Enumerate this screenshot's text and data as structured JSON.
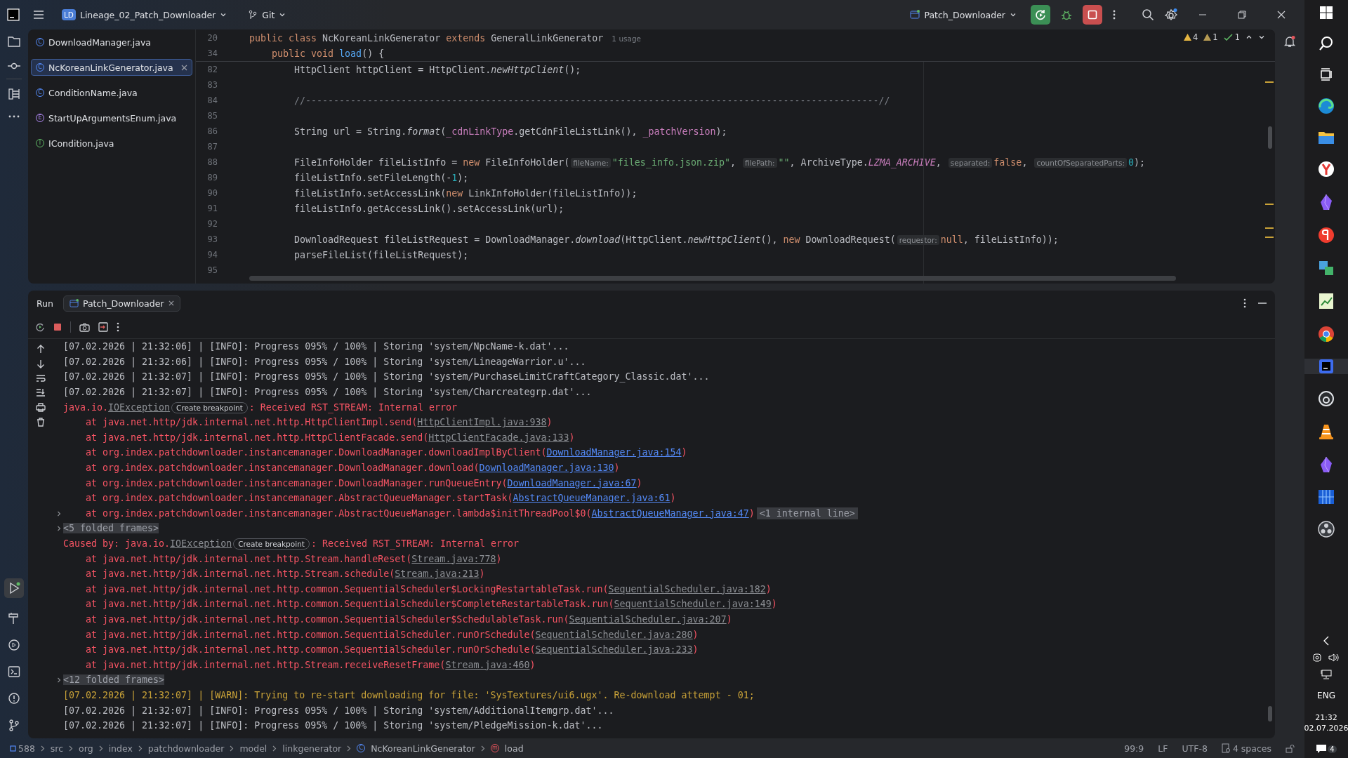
{
  "title_bar": {
    "project_badge": "LD",
    "project": "Lineage_02_Patch_Downloader",
    "vcs": "Git",
    "run_config": "Patch_Downloader"
  },
  "open_files": [
    {
      "name": "DownloadManager.java",
      "kind": "class",
      "letter": "C",
      "selected": false
    },
    {
      "name": "NcKoreanLinkGenerator.java",
      "kind": "class",
      "letter": "C",
      "selected": true
    },
    {
      "name": "ConditionName.java",
      "kind": "class",
      "letter": "C",
      "selected": false
    },
    {
      "name": "StartUpArgumentsEnum.java",
      "kind": "enum",
      "letter": "E",
      "selected": false
    },
    {
      "name": "ICondition.java",
      "kind": "interface",
      "letter": "I",
      "selected": false
    }
  ],
  "inspections": [
    {
      "kind": "warning",
      "count": "4"
    },
    {
      "kind": "weak",
      "count": "1"
    },
    {
      "kind": "ok",
      "count": "1"
    }
  ],
  "code_lines": [
    {
      "number": "20",
      "kind": "class",
      "tokens": [
        {
          "text": "public class ",
          "kind": "kw"
        },
        {
          "text": "NcKoreanLinkGenerator ",
          "kind": "plain"
        },
        {
          "text": "extends ",
          "kind": "kw"
        },
        {
          "text": "GeneralLinkGenerator",
          "kind": "plain"
        },
        {
          "text": "1 usage",
          "kind": "usage"
        }
      ]
    },
    {
      "number": "34",
      "kind": "method",
      "tokens": [
        {
          "text": "public void ",
          "kind": "kw"
        },
        {
          "text": "load",
          "kind": "decl"
        },
        {
          "text": "() {",
          "kind": "plain"
        }
      ]
    },
    {
      "number": "82",
      "kind": "body",
      "tokens": [
        {
          "text": "HttpClient httpClient = HttpClient.",
          "kind": "plain"
        },
        {
          "text": "newHttpClient",
          "kind": "static"
        },
        {
          "text": "();",
          "kind": "plain"
        }
      ]
    },
    {
      "number": "83",
      "kind": "body"
    },
    {
      "number": "84",
      "kind": "body",
      "tokens": [
        {
          "text": "//------------------------------------------------------------------------------------------------------//",
          "kind": "comment"
        }
      ]
    },
    {
      "number": "85",
      "kind": "body"
    },
    {
      "number": "86",
      "kind": "body",
      "tokens": [
        {
          "text": "String url = String.",
          "kind": "plain"
        },
        {
          "text": "format",
          "kind": "static"
        },
        {
          "text": "(",
          "kind": "plain"
        },
        {
          "text": "_cdnLinkType",
          "kind": "field"
        },
        {
          "text": ".getCdnFileListLink(), ",
          "kind": "plain"
        },
        {
          "text": "_patchVersion",
          "kind": "field"
        },
        {
          "text": ");",
          "kind": "plain"
        }
      ]
    },
    {
      "number": "87",
      "kind": "body"
    },
    {
      "number": "88",
      "kind": "body",
      "tokens": [
        {
          "text": "FileInfoHolder fileListInfo = ",
          "kind": "plain"
        },
        {
          "text": "new ",
          "kind": "kw"
        },
        {
          "text": "FileInfoHolder(",
          "kind": "plain"
        },
        {
          "text": "fileName:",
          "kind": "hint"
        },
        {
          "text": "\"files_info.json.zip\"",
          "kind": "string"
        },
        {
          "text": ", ",
          "kind": "plain"
        },
        {
          "text": "filePath:",
          "kind": "hint"
        },
        {
          "text": "\"\"",
          "kind": "string"
        },
        {
          "text": ", ArchiveType.",
          "kind": "plain"
        },
        {
          "text": "LZMA_ARCHIVE",
          "kind": "const"
        },
        {
          "text": ", ",
          "kind": "plain"
        },
        {
          "text": "separated:",
          "kind": "hint"
        },
        {
          "text": "false",
          "kind": "kw"
        },
        {
          "text": ", ",
          "kind": "plain"
        },
        {
          "text": "countOfSeparatedParts:",
          "kind": "hint"
        },
        {
          "text": "0",
          "kind": "num"
        },
        {
          "text": ");",
          "kind": "plain"
        }
      ]
    },
    {
      "number": "89",
      "kind": "body",
      "tokens": [
        {
          "text": "fileListInfo.setFileLength(-",
          "kind": "plain"
        },
        {
          "text": "1",
          "kind": "num"
        },
        {
          "text": ");",
          "kind": "plain"
        }
      ]
    },
    {
      "number": "90",
      "kind": "body",
      "tokens": [
        {
          "text": "fileListInfo.setAccessLink(",
          "kind": "plain"
        },
        {
          "text": "new ",
          "kind": "kw"
        },
        {
          "text": "LinkInfoHolder(fileListInfo));",
          "kind": "plain"
        }
      ]
    },
    {
      "number": "91",
      "kind": "body",
      "tokens": [
        {
          "text": "fileListInfo.getAccessLink().setAccessLink(url);",
          "kind": "plain"
        }
      ]
    },
    {
      "number": "92",
      "kind": "body"
    },
    {
      "number": "93",
      "kind": "body",
      "tokens": [
        {
          "text": "DownloadRequest fileListRequest = DownloadManager.",
          "kind": "plain"
        },
        {
          "text": "download",
          "kind": "static"
        },
        {
          "text": "(HttpClient.",
          "kind": "plain"
        },
        {
          "text": "newHttpClient",
          "kind": "static"
        },
        {
          "text": "(), ",
          "kind": "plain"
        },
        {
          "text": "new ",
          "kind": "kw"
        },
        {
          "text": "DownloadRequest(",
          "kind": "plain"
        },
        {
          "text": "requestor:",
          "kind": "hint"
        },
        {
          "text": "null",
          "kind": "kw"
        },
        {
          "text": ", fileListInfo));",
          "kind": "plain"
        }
      ]
    },
    {
      "number": "94",
      "kind": "body",
      "tokens": [
        {
          "text": "parseFileList(fileListRequest);",
          "kind": "plain"
        }
      ]
    },
    {
      "number": "95",
      "kind": "body"
    }
  ],
  "run_panel": {
    "title": "Run",
    "tab": "Patch_Downloader",
    "lines": [
      {
        "kind": "info",
        "parts": [
          {
            "text": "[07.02.2026 | 21:32:06] | [INFO]: Progress 095% / 100% | Storing 'system/NpcName-k.dat'...",
            "kind": "text"
          }
        ]
      },
      {
        "kind": "info",
        "parts": [
          {
            "text": "[07.02.2026 | 21:32:06] | [INFO]: Progress 095% / 100% | Storing 'system/LineageWarrior.u'...",
            "kind": "text"
          }
        ]
      },
      {
        "kind": "info",
        "parts": [
          {
            "text": "[07.02.2026 | 21:32:07] | [INFO]: Progress 095% / 100% | Storing 'system/PurchaseLimitCraftCategory_Classic.dat'...",
            "kind": "text"
          }
        ]
      },
      {
        "kind": "info",
        "parts": [
          {
            "text": "[07.02.2026 | 21:32:07] | [INFO]: Progress 095% / 100% | Storing 'system/Charcreategrp.dat'...",
            "kind": "text"
          }
        ]
      },
      {
        "kind": "error",
        "parts": [
          {
            "text": "java.io.",
            "kind": "text"
          },
          {
            "text": "IOException",
            "kind": "link"
          },
          {
            "text": "Create breakpoint",
            "kind": "chip"
          },
          {
            "text": ": Received RST_STREAM: Internal error",
            "kind": "text"
          }
        ]
      },
      {
        "kind": "frame",
        "parts": [
          {
            "text": "at java.net.http/jdk.internal.net.http.HttpClientImpl.send(",
            "kind": "text"
          },
          {
            "text": "HttpClientImpl.java:938",
            "kind": "link"
          },
          {
            "text": ")",
            "kind": "text"
          }
        ]
      },
      {
        "kind": "frame",
        "parts": [
          {
            "text": "at java.net.http/jdk.internal.net.http.HttpClientFacade.send(",
            "kind": "text"
          },
          {
            "text": "HttpClientFacade.java:133",
            "kind": "link"
          },
          {
            "text": ")",
            "kind": "text"
          }
        ]
      },
      {
        "kind": "frame",
        "parts": [
          {
            "text": "at org.index.patchdownloader.instancemanager.DownloadManager.downloadImplByClient(",
            "kind": "text"
          },
          {
            "text": "DownloadManager.java:154",
            "kind": "project-link"
          },
          {
            "text": ")",
            "kind": "text"
          }
        ]
      },
      {
        "kind": "frame",
        "parts": [
          {
            "text": "at org.index.patchdownloader.instancemanager.DownloadManager.download(",
            "kind": "text"
          },
          {
            "text": "DownloadManager.java:130",
            "kind": "project-link"
          },
          {
            "text": ")",
            "kind": "text"
          }
        ]
      },
      {
        "kind": "frame",
        "parts": [
          {
            "text": "at org.index.patchdownloader.instancemanager.DownloadManager.runQueueEntry(",
            "kind": "text"
          },
          {
            "text": "DownloadManager.java:67",
            "kind": "project-link"
          },
          {
            "text": ")",
            "kind": "text"
          }
        ]
      },
      {
        "kind": "frame",
        "parts": [
          {
            "text": "at org.index.patchdownloader.instancemanager.AbstractQueueManager.startTask(",
            "kind": "text"
          },
          {
            "text": "AbstractQueueManager.java:61",
            "kind": "project-link"
          },
          {
            "text": ")",
            "kind": "text"
          }
        ]
      },
      {
        "kind": "frame",
        "expanded": false,
        "parts": [
          {
            "text": "at org.index.patchdownloader.instancemanager.AbstractQueueManager.lambda$initThreadPool$0(",
            "kind": "text"
          },
          {
            "text": "AbstractQueueManager.java:47",
            "kind": "project-link"
          },
          {
            "text": ")",
            "kind": "text"
          },
          {
            "text": "<1 internal line>",
            "kind": "badge"
          }
        ]
      },
      {
        "kind": "folded",
        "expanded": false,
        "parts": [
          {
            "text": "<5 folded frames>",
            "kind": "text"
          }
        ]
      },
      {
        "kind": "error",
        "parts": [
          {
            "text": "Caused by: java.io.",
            "kind": "text"
          },
          {
            "text": "IOException",
            "kind": "link"
          },
          {
            "text": "Create breakpoint",
            "kind": "chip"
          },
          {
            "text": ": Received RST_STREAM: Internal error",
            "kind": "text"
          }
        ]
      },
      {
        "kind": "frame",
        "parts": [
          {
            "text": "at java.net.http/jdk.internal.net.http.Stream.handleReset(",
            "kind": "text"
          },
          {
            "text": "Stream.java:778",
            "kind": "link"
          },
          {
            "text": ")",
            "kind": "text"
          }
        ]
      },
      {
        "kind": "frame",
        "parts": [
          {
            "text": "at java.net.http/jdk.internal.net.http.Stream.schedule(",
            "kind": "text"
          },
          {
            "text": "Stream.java:213",
            "kind": "link"
          },
          {
            "text": ")",
            "kind": "text"
          }
        ]
      },
      {
        "kind": "frame",
        "parts": [
          {
            "text": "at java.net.http/jdk.internal.net.http.common.SequentialScheduler$LockingRestartableTask.run(",
            "kind": "text"
          },
          {
            "text": "SequentialScheduler.java:182",
            "kind": "link"
          },
          {
            "text": ")",
            "kind": "text"
          }
        ]
      },
      {
        "kind": "frame",
        "parts": [
          {
            "text": "at java.net.http/jdk.internal.net.http.common.SequentialScheduler$CompleteRestartableTask.run(",
            "kind": "text"
          },
          {
            "text": "SequentialScheduler.java:149",
            "kind": "link"
          },
          {
            "text": ")",
            "kind": "text"
          }
        ]
      },
      {
        "kind": "frame",
        "parts": [
          {
            "text": "at java.net.http/jdk.internal.net.http.common.SequentialScheduler$SchedulableTask.run(",
            "kind": "text"
          },
          {
            "text": "SequentialScheduler.java:207",
            "kind": "link"
          },
          {
            "text": ")",
            "kind": "text"
          }
        ]
      },
      {
        "kind": "frame",
        "parts": [
          {
            "text": "at java.net.http/jdk.internal.net.http.common.SequentialScheduler.runOrSchedule(",
            "kind": "text"
          },
          {
            "text": "SequentialScheduler.java:280",
            "kind": "link"
          },
          {
            "text": ")",
            "kind": "text"
          }
        ]
      },
      {
        "kind": "frame",
        "parts": [
          {
            "text": "at java.net.http/jdk.internal.net.http.common.SequentialScheduler.runOrSchedule(",
            "kind": "text"
          },
          {
            "text": "SequentialScheduler.java:233",
            "kind": "link"
          },
          {
            "text": ")",
            "kind": "text"
          }
        ]
      },
      {
        "kind": "frame",
        "parts": [
          {
            "text": "at java.net.http/jdk.internal.net.http.Stream.receiveResetFrame(",
            "kind": "text"
          },
          {
            "text": "Stream.java:460",
            "kind": "link"
          },
          {
            "text": ")",
            "kind": "text"
          }
        ]
      },
      {
        "kind": "folded",
        "expanded": false,
        "parts": [
          {
            "text": "<12 folded frames>",
            "kind": "text"
          }
        ]
      },
      {
        "kind": "warn",
        "parts": [
          {
            "text": "[07.02.2026 | 21:32:07] | [WARN]: Trying to re-start downloading for file: 'SysTextures/ui6.ugx'. Re-download attempt - 01;",
            "kind": "text"
          }
        ]
      },
      {
        "kind": "info",
        "parts": [
          {
            "text": "[07.02.2026 | 21:32:07] | [INFO]: Progress 095% / 100% | Storing 'system/AdditionalItemgrp.dat'...",
            "kind": "text"
          }
        ]
      },
      {
        "kind": "info",
        "parts": [
          {
            "text": "[07.02.2026 | 21:32:07] | [INFO]: Progress 095% / 100% | Storing 'system/PledgeMission-k.dat'...",
            "kind": "text"
          }
        ]
      }
    ]
  },
  "status_bar": {
    "project_count": "588",
    "breadcrumbs": [
      {
        "text": "src",
        "kind": "dir"
      },
      {
        "text": "org",
        "kind": "dir"
      },
      {
        "text": "index",
        "kind": "dir"
      },
      {
        "text": "patchdownloader",
        "kind": "dir"
      },
      {
        "text": "model",
        "kind": "dir"
      },
      {
        "text": "linkgenerator",
        "kind": "dir"
      },
      {
        "text": "NcKoreanLinkGenerator",
        "kind": "class",
        "letter": "C"
      },
      {
        "text": "load",
        "kind": "method",
        "letter": "m"
      }
    ],
    "position": "99:9",
    "line_ending": "LF",
    "encoding": "UTF-8",
    "indent": "4 spaces"
  },
  "taskbar": {
    "language": "ENG",
    "time": "21:32",
    "date": "02.07.2026",
    "notifications": "4"
  }
}
